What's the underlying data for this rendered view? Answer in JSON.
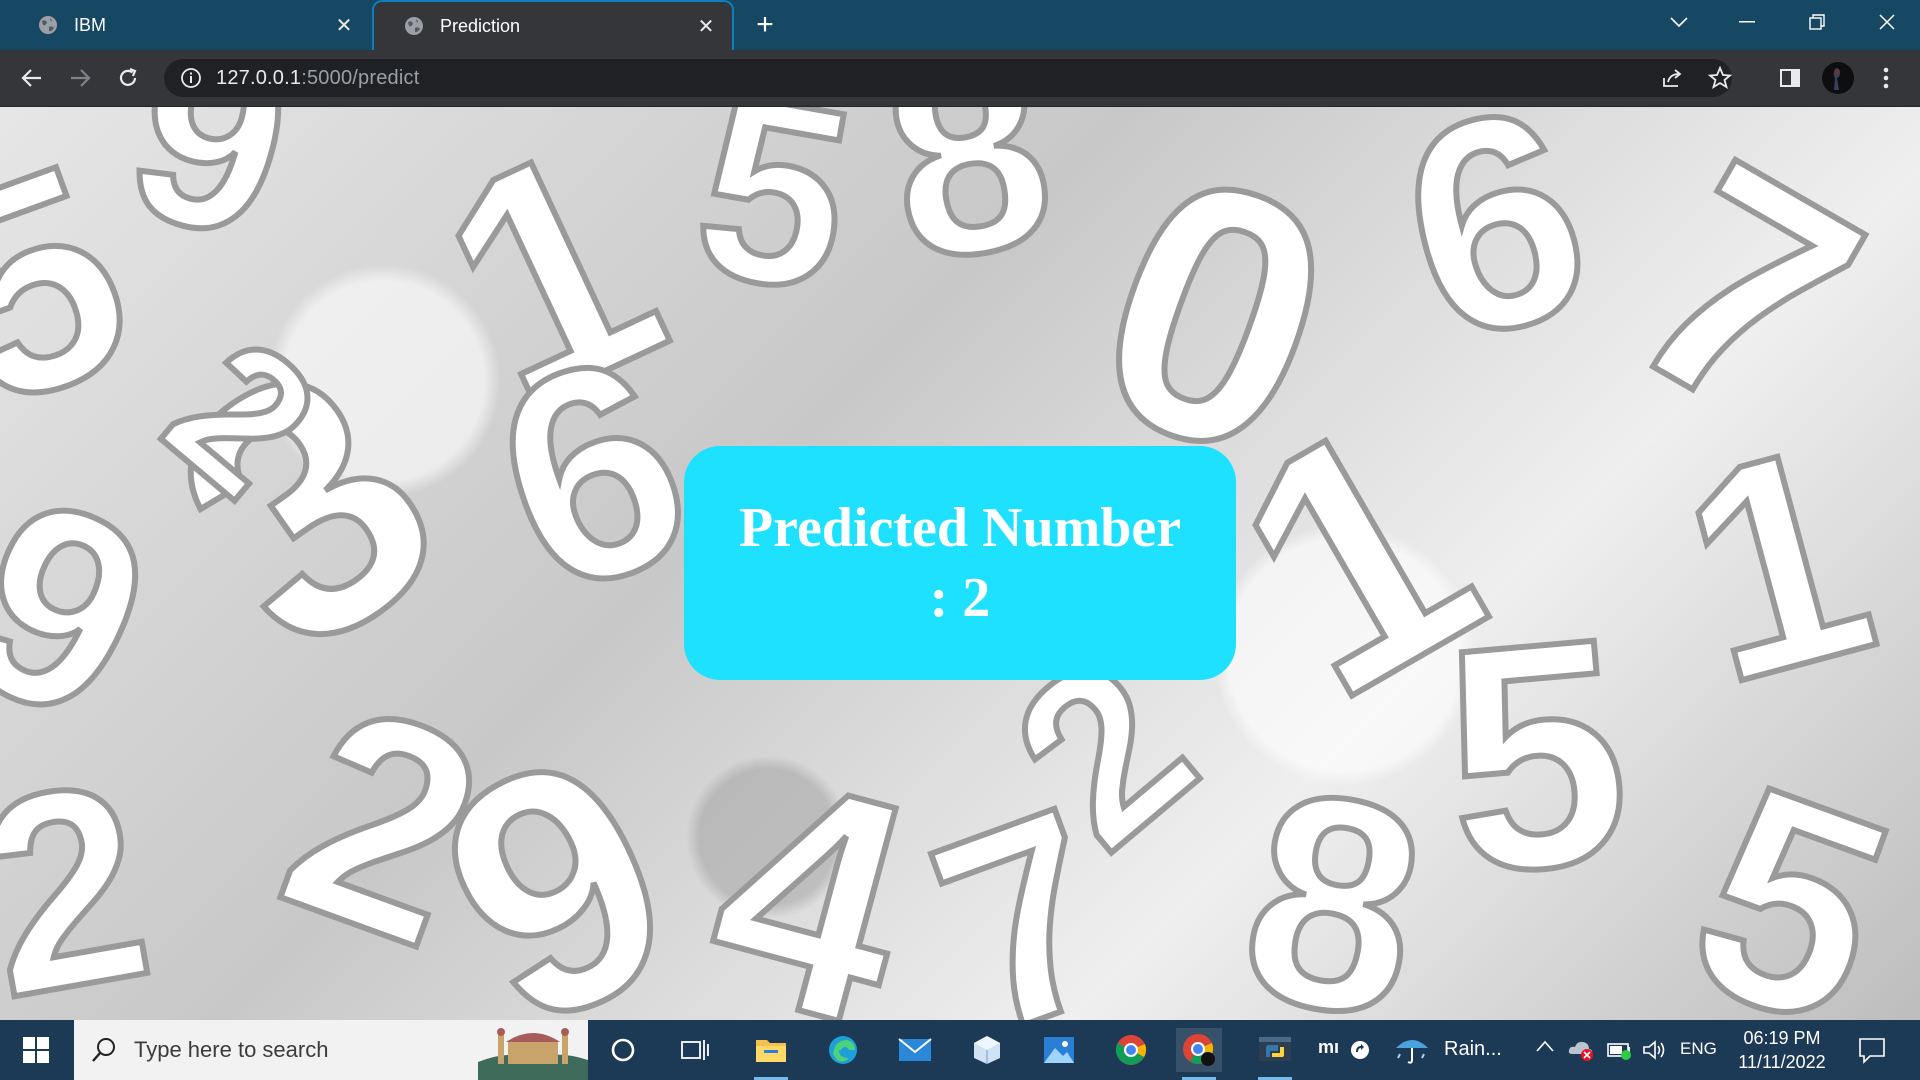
{
  "browser": {
    "tabs": [
      {
        "title": "IBM",
        "active": false
      },
      {
        "title": "Prediction",
        "active": true
      }
    ],
    "url_host": "127.0.0.1",
    "url_rest": ":5000/predict"
  },
  "page": {
    "result_label": "Predicted Number",
    "result_value": ": 2",
    "card_color": "#1ee1ff"
  },
  "taskbar": {
    "search_placeholder": "Type here to search",
    "weather": "Rain...",
    "language": "ENG",
    "time": "06:19 PM",
    "date": "11/11/2022"
  },
  "icons": [
    "globe-icon",
    "close-icon",
    "plus-icon",
    "chevron-down-icon",
    "minimize-icon",
    "restore-icon",
    "back-icon",
    "forward-icon",
    "reload-icon",
    "info-icon",
    "share-icon",
    "star-icon",
    "sidepanel-icon",
    "profile-avatar",
    "menu-icon",
    "windows-icon",
    "search-icon",
    "cortana-icon",
    "task-view-icon",
    "file-explorer-icon",
    "edge-icon",
    "mail-icon",
    "package-icon",
    "photos-icon",
    "chrome-icon",
    "python-icon",
    "weather-icon",
    "notification-icon"
  ]
}
